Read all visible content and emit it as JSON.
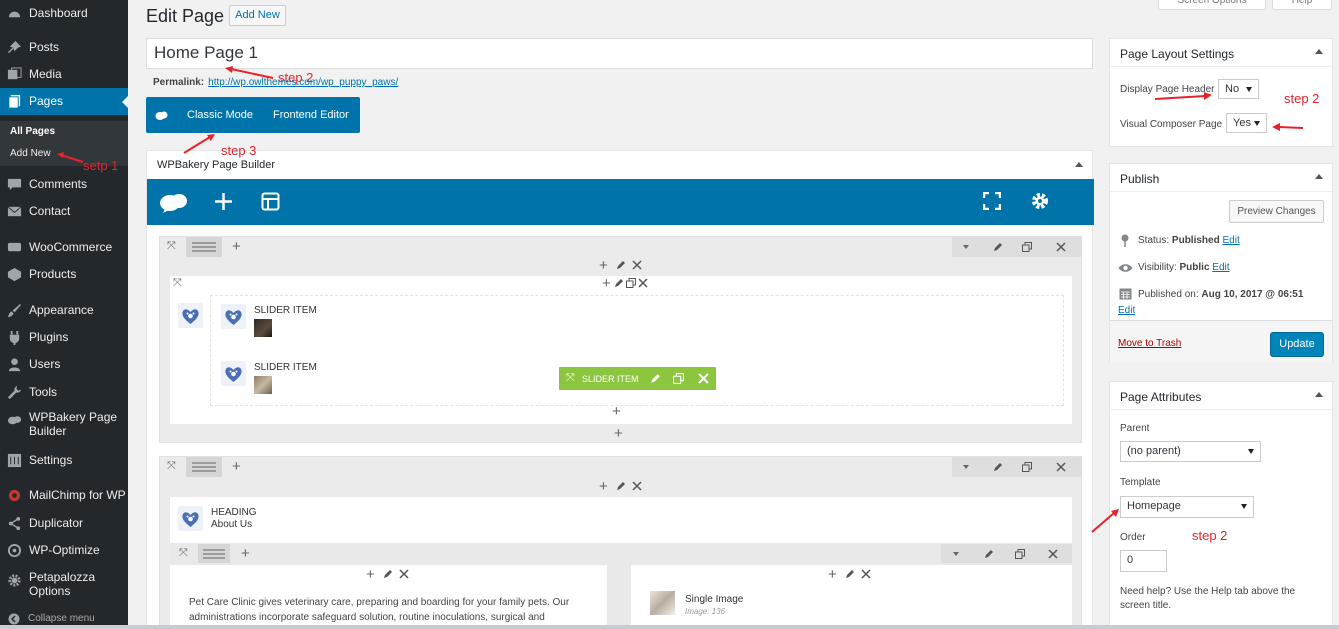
{
  "sidebar": {
    "items": [
      {
        "label": "Dashboard",
        "icon": "dashboard-icon"
      },
      {
        "label": "Posts",
        "icon": "pin-icon"
      },
      {
        "label": "Media",
        "icon": "media-icon"
      },
      {
        "label": "Pages",
        "icon": "pages-icon"
      },
      {
        "label": "Comments",
        "icon": "comment-icon"
      },
      {
        "label": "Contact",
        "icon": "mail-icon"
      },
      {
        "label": "WooCommerce",
        "icon": "woocommerce-icon"
      },
      {
        "label": "Products",
        "icon": "products-icon"
      },
      {
        "label": "Appearance",
        "icon": "brush-icon"
      },
      {
        "label": "Plugins",
        "icon": "plugin-icon"
      },
      {
        "label": "Users",
        "icon": "user-icon"
      },
      {
        "label": "Tools",
        "icon": "wrench-icon"
      },
      {
        "label": "WPBakery Page Builder",
        "icon": "wpbakery-icon"
      },
      {
        "label": "Settings",
        "icon": "settings-icon"
      },
      {
        "label": "MailChimp for WP",
        "icon": "mailchimp-icon"
      },
      {
        "label": "Duplicator",
        "icon": "duplicator-icon"
      },
      {
        "label": "WP-Optimize",
        "icon": "optimize-icon"
      },
      {
        "label": "Petapalozza Options",
        "icon": "gear-icon"
      }
    ],
    "submenu": {
      "all_pages": "All Pages",
      "add_new": "Add New"
    },
    "collapse": "Collapse menu"
  },
  "header": {
    "title": "Edit Page",
    "add_new": "Add New",
    "screen_options": "Screen Options",
    "help": "Help"
  },
  "editor": {
    "page_title": "Home Page 1",
    "permalink_label": "Permalink:",
    "permalink_url": "http://wp.owlthemes.com/wp_puppy_paws/",
    "classic_mode": "Classic Mode",
    "frontend_editor": "Frontend Editor"
  },
  "builder": {
    "title": "WPBakery Page Builder",
    "row1": {
      "items": [
        {
          "name": "SLIDER ITEM"
        },
        {
          "name": "SLIDER ITEM"
        }
      ],
      "hover_label": "SLIDER ITEM"
    },
    "row2": {
      "heading_name": "HEADING",
      "heading_sub": "About Us",
      "text_preview": "Pet Care Clinic gives veterinary care, preparing and boarding for your family pets. Our administrations incorporate safeguard solution, routine inoculations, surgical and",
      "image_name": "Single Image",
      "image_sub": "Image: 136"
    }
  },
  "layout_settings": {
    "title": "Page Layout Settings",
    "display_header_label": "Display Page Header",
    "display_header_value": "No",
    "vc_page_label": "Visual Composer Page",
    "vc_page_value": "Yes"
  },
  "publish": {
    "title": "Publish",
    "preview": "Preview Changes",
    "status_label": "Status:",
    "status_value": "Published",
    "visibility_label": "Visibility:",
    "visibility_value": "Public",
    "published_label": "Published on:",
    "published_value": "Aug 10, 2017 @ 06:51",
    "edit": "Edit",
    "trash": "Move to Trash",
    "update": "Update"
  },
  "attributes": {
    "title": "Page Attributes",
    "parent_label": "Parent",
    "parent_value": "(no parent)",
    "template_label": "Template",
    "template_value": "Homepage",
    "order_label": "Order",
    "order_value": "0",
    "help": "Need help? Use the Help tab above the screen title."
  },
  "annotations": {
    "setp1": "setp 1",
    "step2_title": "step 2",
    "step3": "step 3",
    "step2_layout": "step 2",
    "step2_template": "step 2"
  },
  "colors": {
    "wp_blue": "#0073aa",
    "sidebar": "#23282d",
    "annotation_red": "#e8222a",
    "vc_green": "#8cc63e"
  }
}
